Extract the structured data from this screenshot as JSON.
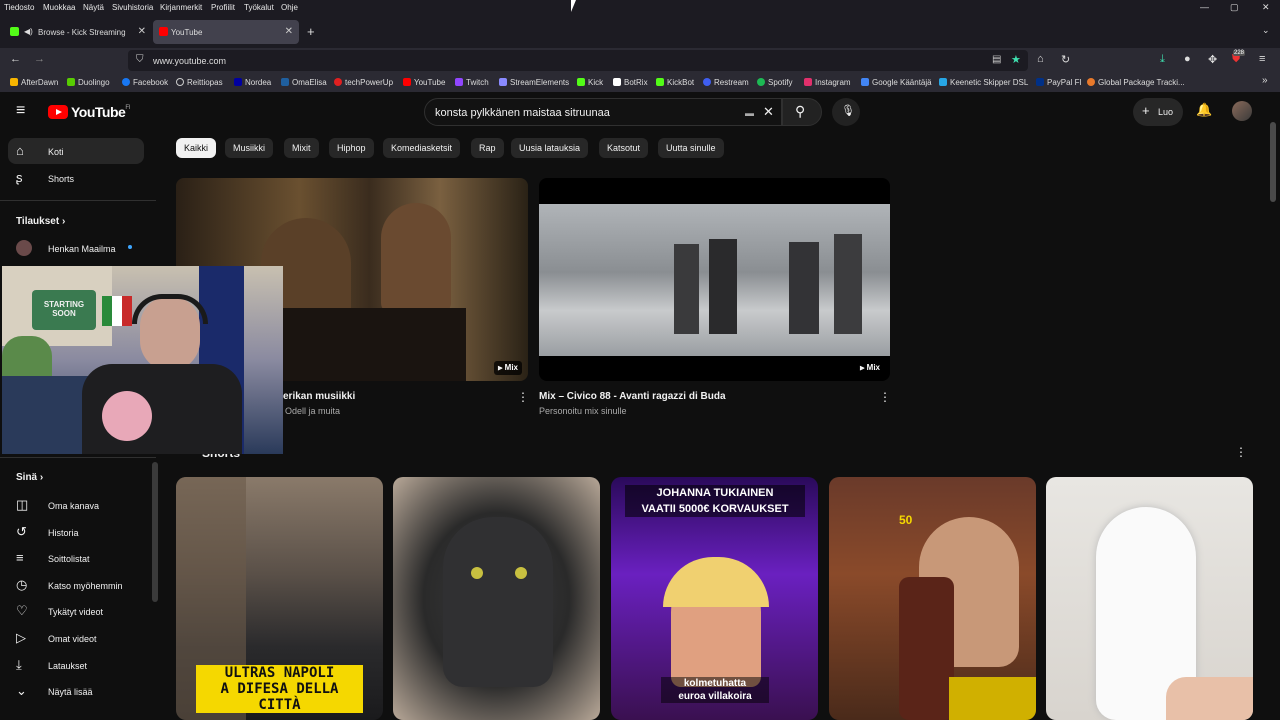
{
  "menubar": [
    "Tiedosto",
    "Muokkaa",
    "Näytä",
    "Sivuhistoria",
    "Kirjanmerkit",
    "Profiilit",
    "Työkalut",
    "Ohje"
  ],
  "window_controls": {
    "minimize": "—",
    "restore": "▢",
    "close": "✕"
  },
  "tabs": [
    {
      "label": "Browse - Kick Streaming",
      "icon": "kick-icon",
      "color": "#53fc18",
      "active": false
    },
    {
      "label": "YouTube",
      "icon": "youtube-icon",
      "color": "#ff0000",
      "active": true
    }
  ],
  "new_tab": "+",
  "address": {
    "url": "www.youtube.com",
    "badge_count": "228"
  },
  "bookmarks": [
    {
      "label": "AfterDawn",
      "color": "#f7b500"
    },
    {
      "label": "Duolingo",
      "color": "#58cc02"
    },
    {
      "label": "Facebook",
      "color": "#1877f2"
    },
    {
      "label": "Reittiopas",
      "color": "#cccccc"
    },
    {
      "label": "Nordea",
      "color": "#0000a0"
    },
    {
      "label": "OmaElisa",
      "color": "#1f5f9f"
    },
    {
      "label": "techPowerUp",
      "color": "#e02020"
    },
    {
      "label": "YouTube",
      "color": "#ff0000"
    },
    {
      "label": "Twitch",
      "color": "#9146ff"
    },
    {
      "label": "StreamElements",
      "color": "#8a8aff"
    },
    {
      "label": "Kick",
      "color": "#53fc18"
    },
    {
      "label": "BotRix",
      "color": "#ffffff"
    },
    {
      "label": "KickBot",
      "color": "#53fc18"
    },
    {
      "label": "Restream",
      "color": "#3f5ef0"
    },
    {
      "label": "Spotify",
      "color": "#1db954"
    },
    {
      "label": "Instagram",
      "color": "#e1306c"
    },
    {
      "label": "Google Kääntäjä",
      "color": "#4285f4"
    },
    {
      "label": "Keenetic Skipper DSL",
      "color": "#27a6e5"
    },
    {
      "label": "PayPal FI",
      "color": "#003087"
    },
    {
      "label": "Global Package Tracki...",
      "color": "#e8792b"
    }
  ],
  "youtube": {
    "logo": "YouTube",
    "region": "FI",
    "search_query": "konsta pylkkänen maistaa sitruunaa",
    "create_label": "Luo",
    "chips": [
      "Kaikki",
      "Musiikki",
      "Mixit",
      "Hiphop",
      "Komediasketsit",
      "Rap",
      "Uusia latauksia",
      "Katsotut",
      "Uutta sinulle"
    ],
    "sidebar_top": [
      {
        "label": "Koti",
        "icon": "home-icon",
        "glyph": "⌂"
      },
      {
        "label": "Shorts",
        "icon": "shorts-icon",
        "glyph": "ʂ"
      }
    ],
    "subscriptions_title": "Tilaukset",
    "subscriptions": [
      {
        "label": "Henkan Maailma"
      }
    ],
    "you_title": "Sinä",
    "sidebar_you": [
      {
        "label": "Oma kanava",
        "icon": "channel-icon",
        "glyph": "◫"
      },
      {
        "label": "Historia",
        "icon": "history-icon",
        "glyph": "↺"
      },
      {
        "label": "Soittolistat",
        "icon": "playlists-icon",
        "glyph": "≡"
      },
      {
        "label": "Katso myöhemmin",
        "icon": "clock-icon",
        "glyph": "◷"
      },
      {
        "label": "Tykätyt videot",
        "icon": "like-icon",
        "glyph": "♡"
      },
      {
        "label": "Omat videot",
        "icon": "my-videos-icon",
        "glyph": "▷"
      },
      {
        "label": "Lataukset",
        "icon": "download-icon",
        "glyph": "⤓"
      },
      {
        "label": "Näytä lisää",
        "icon": "chevron-down-icon",
        "glyph": "⌄"
      }
    ],
    "videos": [
      {
        "title": "erikan musiikki",
        "subtitle": "om Odell ja muita",
        "badge": "Mix"
      },
      {
        "title": "Mix – Civico 88 - Avanti ragazzi di Buda",
        "subtitle": "Personoitu mix sinulle",
        "badge": "Mix"
      }
    ],
    "shorts_title": "Shorts",
    "shorts": [
      {
        "overlay": "ULTRAS NAPOLI\nA DIFESA DELLA\nCITTÀ"
      },
      {
        "overlay": ""
      },
      {
        "overlay_top": "JOHANNA TUKIAINEN\nVAATII 5000€ KORVAUKSET",
        "overlay_bottom": "kolmetuhatta\neuroa villakoira"
      },
      {
        "overlay": "50"
      },
      {
        "overlay": ""
      }
    ]
  },
  "webcam": {
    "sign": "STARTING SOON"
  }
}
